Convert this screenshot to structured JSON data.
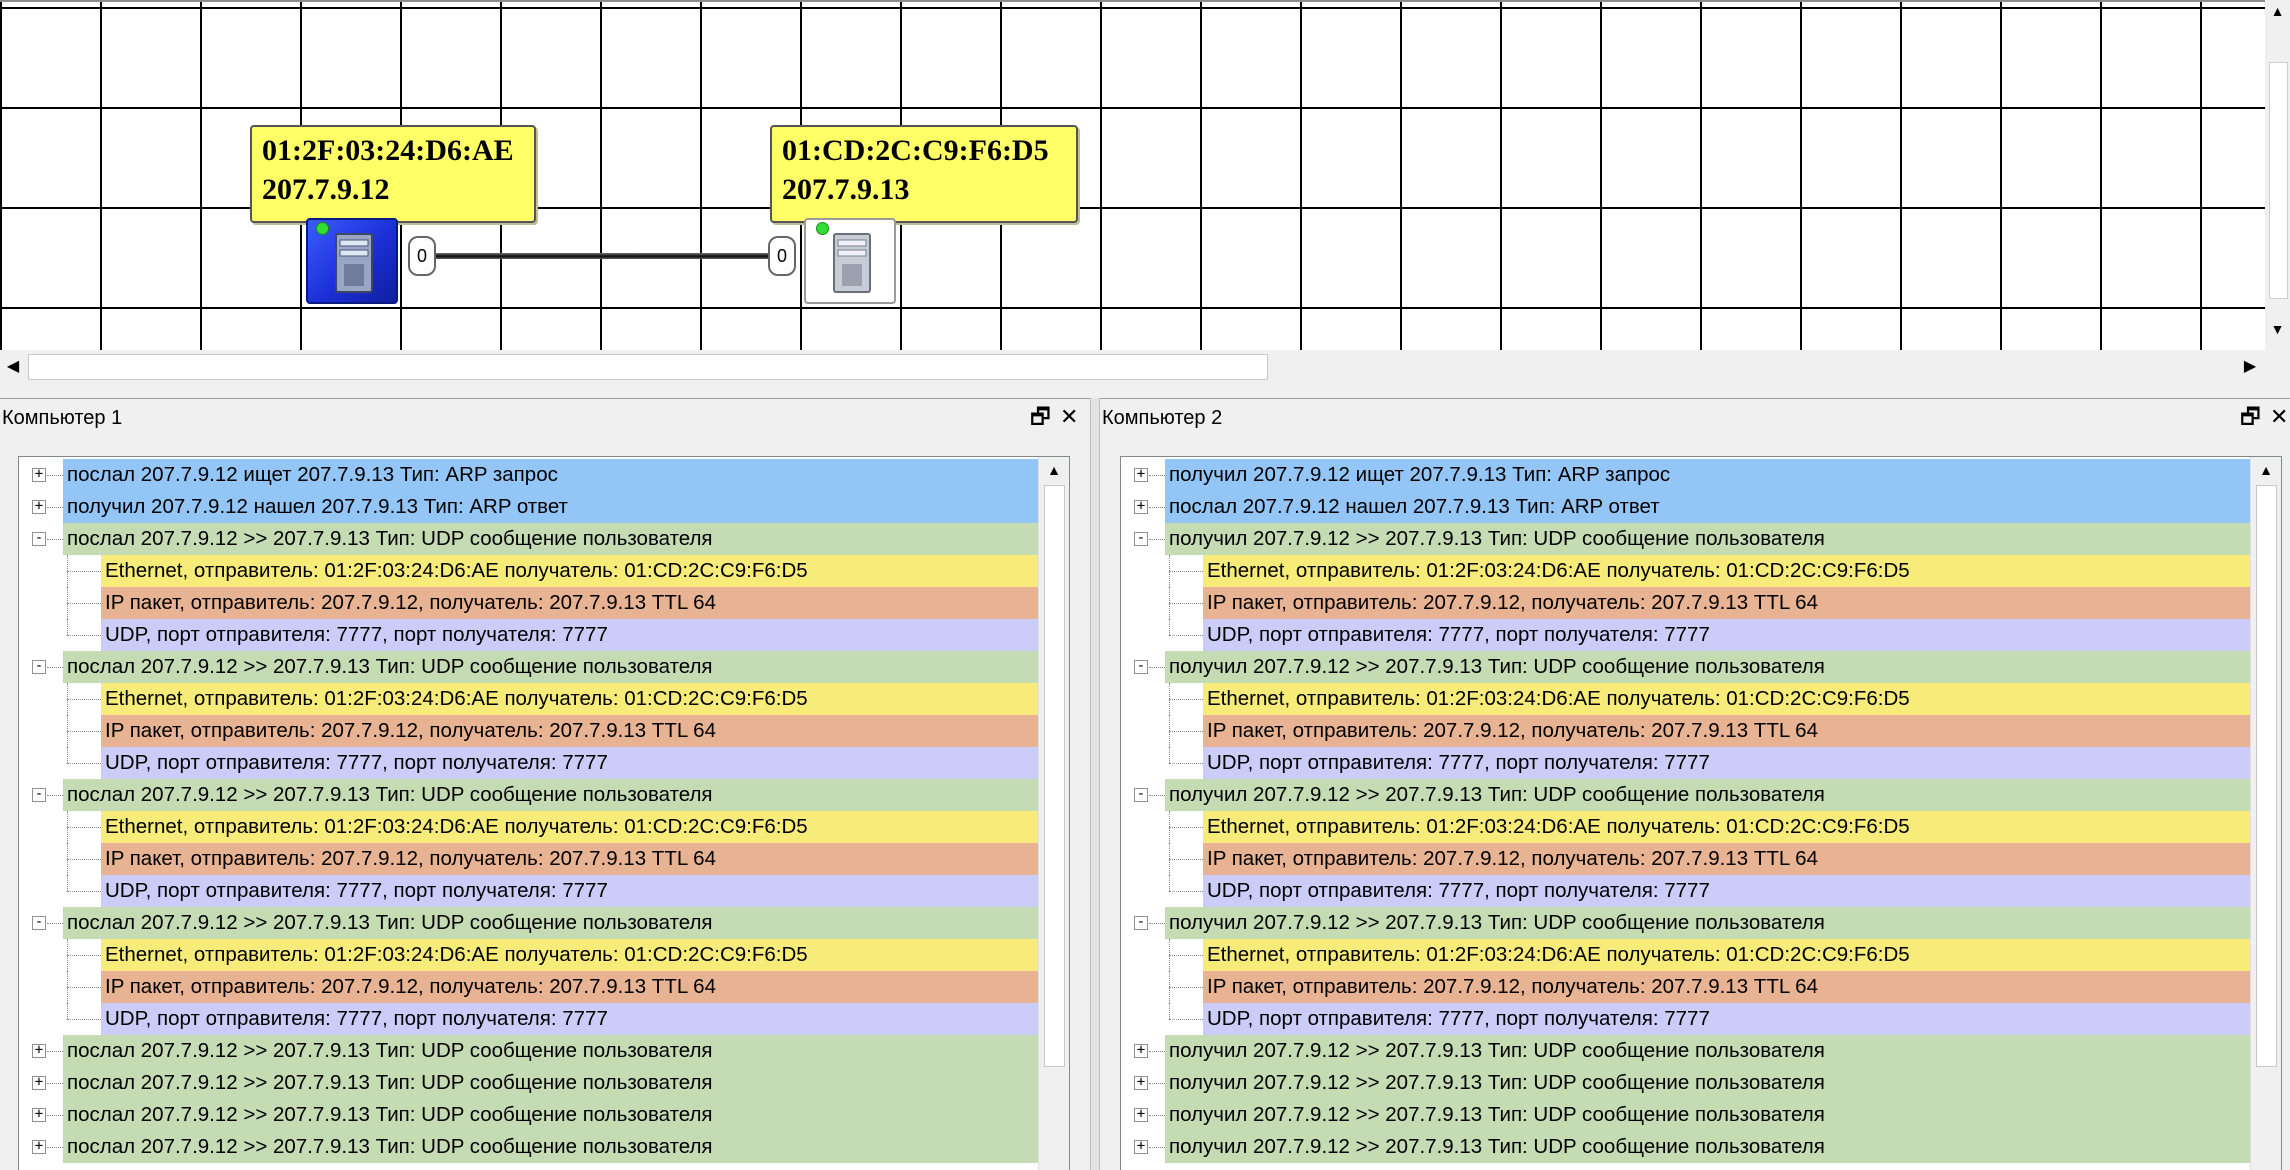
{
  "colors": {
    "arp": "#93c5f6",
    "udp_msg": "#c4dbb4",
    "ethernet": "#f7ec7a",
    "ip": "#e8b392",
    "udp": "#ccccf8",
    "label_bg": "#ffff66",
    "selected_node": "#2040f0"
  },
  "network": {
    "node1": {
      "mac": "01:2F:03:24:D6:AE",
      "ip": "207.7.9.12",
      "port": "0",
      "icon": "computer-icon",
      "selected": true
    },
    "node2": {
      "mac": "01:CD:2C:C9:F6:D5",
      "ip": "207.7.9.13",
      "port": "0",
      "icon": "computer-icon",
      "selected": false
    }
  },
  "panels": [
    {
      "title": "Компьютер 1",
      "restore_icon": "restore-window-icon",
      "close_icon": "close-icon",
      "rows": [
        {
          "level": 0,
          "kind": "arp",
          "expander": "+",
          "text": "послал 207.7.9.12 ищет 207.7.9.13 Тип: ARP запрос"
        },
        {
          "level": 0,
          "kind": "arp",
          "expander": "+",
          "text": "получил 207.7.9.12 нашел 207.7.9.13 Тип: ARP ответ"
        },
        {
          "level": 0,
          "kind": "udp_msg",
          "expander": "-",
          "text": "послал 207.7.9.12 >> 207.7.9.13 Тип: UDP сообщение пользователя"
        },
        {
          "level": 1,
          "kind": "ethernet",
          "text": "Ethernet, отправитель: 01:2F:03:24:D6:AE получатель: 01:CD:2C:C9:F6:D5"
        },
        {
          "level": 1,
          "kind": "ip",
          "text": "IP пакет, отправитель: 207.7.9.12, получатель: 207.7.9.13 TTL 64"
        },
        {
          "level": 1,
          "kind": "udp",
          "last": true,
          "text": "UDP, порт отправителя: 7777, порт получателя: 7777"
        },
        {
          "level": 0,
          "kind": "udp_msg",
          "expander": "-",
          "text": "послал 207.7.9.12 >> 207.7.9.13 Тип: UDP сообщение пользователя"
        },
        {
          "level": 1,
          "kind": "ethernet",
          "text": "Ethernet, отправитель: 01:2F:03:24:D6:AE получатель: 01:CD:2C:C9:F6:D5"
        },
        {
          "level": 1,
          "kind": "ip",
          "text": "IP пакет, отправитель: 207.7.9.12, получатель: 207.7.9.13 TTL 64"
        },
        {
          "level": 1,
          "kind": "udp",
          "last": true,
          "text": "UDP, порт отправителя: 7777, порт получателя: 7777"
        },
        {
          "level": 0,
          "kind": "udp_msg",
          "expander": "-",
          "text": "послал 207.7.9.12 >> 207.7.9.13 Тип: UDP сообщение пользователя"
        },
        {
          "level": 1,
          "kind": "ethernet",
          "text": "Ethernet, отправитель: 01:2F:03:24:D6:AE получатель: 01:CD:2C:C9:F6:D5"
        },
        {
          "level": 1,
          "kind": "ip",
          "text": "IP пакет, отправитель: 207.7.9.12, получатель: 207.7.9.13 TTL 64"
        },
        {
          "level": 1,
          "kind": "udp",
          "last": true,
          "text": "UDP, порт отправителя: 7777, порт получателя: 7777"
        },
        {
          "level": 0,
          "kind": "udp_msg",
          "expander": "-",
          "text": "послал 207.7.9.12 >> 207.7.9.13 Тип: UDP сообщение пользователя"
        },
        {
          "level": 1,
          "kind": "ethernet",
          "text": "Ethernet, отправитель: 01:2F:03:24:D6:AE получатель: 01:CD:2C:C9:F6:D5"
        },
        {
          "level": 1,
          "kind": "ip",
          "text": "IP пакет, отправитель: 207.7.9.12, получатель: 207.7.9.13 TTL 64"
        },
        {
          "level": 1,
          "kind": "udp",
          "last": true,
          "text": "UDP, порт отправителя: 7777, порт получателя: 7777"
        },
        {
          "level": 0,
          "kind": "udp_msg",
          "expander": "+",
          "text": "послал 207.7.9.12 >> 207.7.9.13 Тип: UDP сообщение пользователя"
        },
        {
          "level": 0,
          "kind": "udp_msg",
          "expander": "+",
          "text": "послал 207.7.9.12 >> 207.7.9.13 Тип: UDP сообщение пользователя"
        },
        {
          "level": 0,
          "kind": "udp_msg",
          "expander": "+",
          "text": "послал 207.7.9.12 >> 207.7.9.13 Тип: UDP сообщение пользователя"
        },
        {
          "level": 0,
          "kind": "udp_msg",
          "expander": "+",
          "text": "послал 207.7.9.12 >> 207.7.9.13 Тип: UDP сообщение пользователя"
        }
      ]
    },
    {
      "title": "Компьютер 2",
      "restore_icon": "restore-window-icon",
      "close_icon": "close-icon",
      "rows": [
        {
          "level": 0,
          "kind": "arp",
          "expander": "+",
          "text": "получил 207.7.9.12 ищет 207.7.9.13 Тип: ARP запрос"
        },
        {
          "level": 0,
          "kind": "arp",
          "expander": "+",
          "text": "послал 207.7.9.12 нашел 207.7.9.13 Тип: ARP ответ"
        },
        {
          "level": 0,
          "kind": "udp_msg",
          "expander": "-",
          "text": "получил 207.7.9.12 >> 207.7.9.13 Тип: UDP сообщение пользователя"
        },
        {
          "level": 1,
          "kind": "ethernet",
          "text": "Ethernet, отправитель: 01:2F:03:24:D6:AE получатель: 01:CD:2C:C9:F6:D5"
        },
        {
          "level": 1,
          "kind": "ip",
          "text": "IP пакет, отправитель: 207.7.9.12, получатель: 207.7.9.13 TTL 64"
        },
        {
          "level": 1,
          "kind": "udp",
          "last": true,
          "text": "UDP, порт отправителя: 7777, порт получателя: 7777"
        },
        {
          "level": 0,
          "kind": "udp_msg",
          "expander": "-",
          "text": "получил 207.7.9.12 >> 207.7.9.13 Тип: UDP сообщение пользователя"
        },
        {
          "level": 1,
          "kind": "ethernet",
          "text": "Ethernet, отправитель: 01:2F:03:24:D6:AE получатель: 01:CD:2C:C9:F6:D5"
        },
        {
          "level": 1,
          "kind": "ip",
          "text": "IP пакет, отправитель: 207.7.9.12, получатель: 207.7.9.13 TTL 64"
        },
        {
          "level": 1,
          "kind": "udp",
          "last": true,
          "text": "UDP, порт отправителя: 7777, порт получателя: 7777"
        },
        {
          "level": 0,
          "kind": "udp_msg",
          "expander": "-",
          "text": "получил 207.7.9.12 >> 207.7.9.13 Тип: UDP сообщение пользователя"
        },
        {
          "level": 1,
          "kind": "ethernet",
          "text": "Ethernet, отправитель: 01:2F:03:24:D6:AE получатель: 01:CD:2C:C9:F6:D5"
        },
        {
          "level": 1,
          "kind": "ip",
          "text": "IP пакет, отправитель: 207.7.9.12, получатель: 207.7.9.13 TTL 64"
        },
        {
          "level": 1,
          "kind": "udp",
          "last": true,
          "text": "UDP, порт отправителя: 7777, порт получателя: 7777"
        },
        {
          "level": 0,
          "kind": "udp_msg",
          "expander": "-",
          "text": "получил 207.7.9.12 >> 207.7.9.13 Тип: UDP сообщение пользователя"
        },
        {
          "level": 1,
          "kind": "ethernet",
          "text": "Ethernet, отправитель: 01:2F:03:24:D6:AE получатель: 01:CD:2C:C9:F6:D5"
        },
        {
          "level": 1,
          "kind": "ip",
          "text": "IP пакет, отправитель: 207.7.9.12, получатель: 207.7.9.13 TTL 64"
        },
        {
          "level": 1,
          "kind": "udp",
          "last": true,
          "text": "UDP, порт отправителя: 7777, порт получателя: 7777"
        },
        {
          "level": 0,
          "kind": "udp_msg",
          "expander": "+",
          "text": "получил 207.7.9.12 >> 207.7.9.13 Тип: UDP сообщение пользователя"
        },
        {
          "level": 0,
          "kind": "udp_msg",
          "expander": "+",
          "text": "получил 207.7.9.12 >> 207.7.9.13 Тип: UDP сообщение пользователя"
        },
        {
          "level": 0,
          "kind": "udp_msg",
          "expander": "+",
          "text": "получил 207.7.9.12 >> 207.7.9.13 Тип: UDP сообщение пользователя"
        },
        {
          "level": 0,
          "kind": "udp_msg",
          "expander": "+",
          "text": "получил 207.7.9.12 >> 207.7.9.13 Тип: UDP сообщение пользователя"
        }
      ]
    }
  ]
}
